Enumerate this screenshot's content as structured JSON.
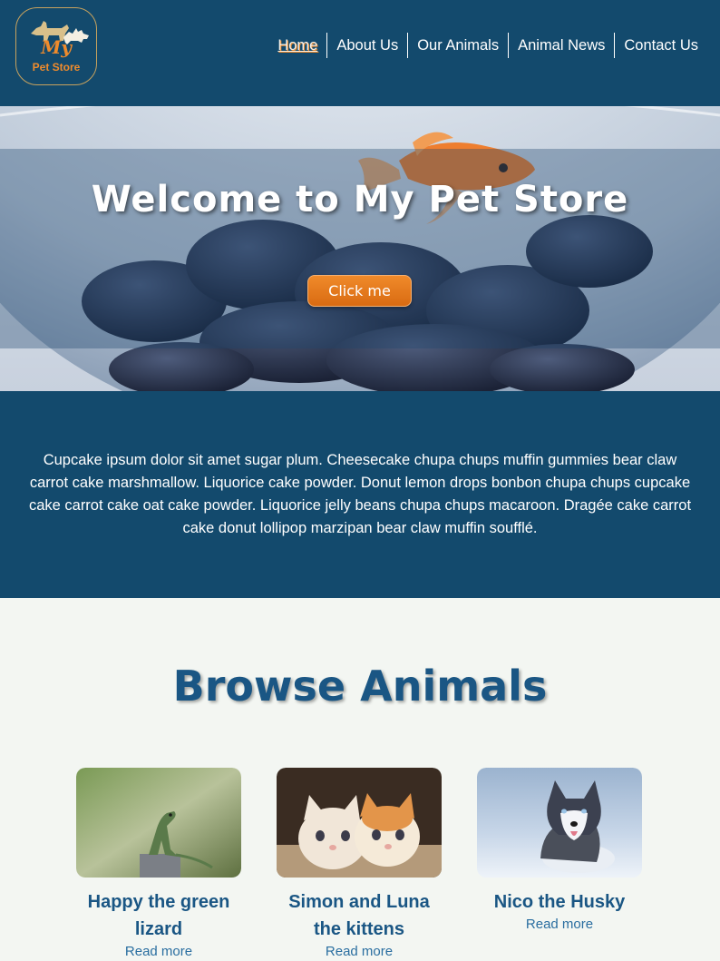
{
  "header": {
    "logo": {
      "line1": "My",
      "line2": "Pet Store"
    },
    "nav": [
      {
        "label": "Home"
      },
      {
        "label": "About Us"
      },
      {
        "label": "Our Animals"
      },
      {
        "label": "Animal News"
      },
      {
        "label": "Contact Us"
      }
    ]
  },
  "hero": {
    "title": "Welcome to My Pet Store",
    "button_label": "Click me"
  },
  "intro": {
    "text": "Cupcake ipsum dolor sit amet sugar plum. Cheesecake chupa chups muffin gummies bear claw carrot cake marshmallow. Liquorice cake powder. Donut lemon drops bonbon chupa chups cupcake cake carrot cake oat cake powder. Liquorice jelly beans chupa chups macaroon. Dragée cake carrot cake donut lollipop marzipan bear claw muffin soufflé."
  },
  "browse": {
    "title": "Browse Animals",
    "cards": [
      {
        "name": "Happy the green lizard",
        "link": "Read more"
      },
      {
        "name": "Simon and Luna the kittens",
        "link": "Read more"
      },
      {
        "name": "Nico the Husky",
        "link": "Read more"
      }
    ]
  },
  "colors": {
    "navy": "#134a6d",
    "accent": "#ef8b2c",
    "heading_blue": "#1a5684",
    "page_bg": "#f3f6f2"
  }
}
